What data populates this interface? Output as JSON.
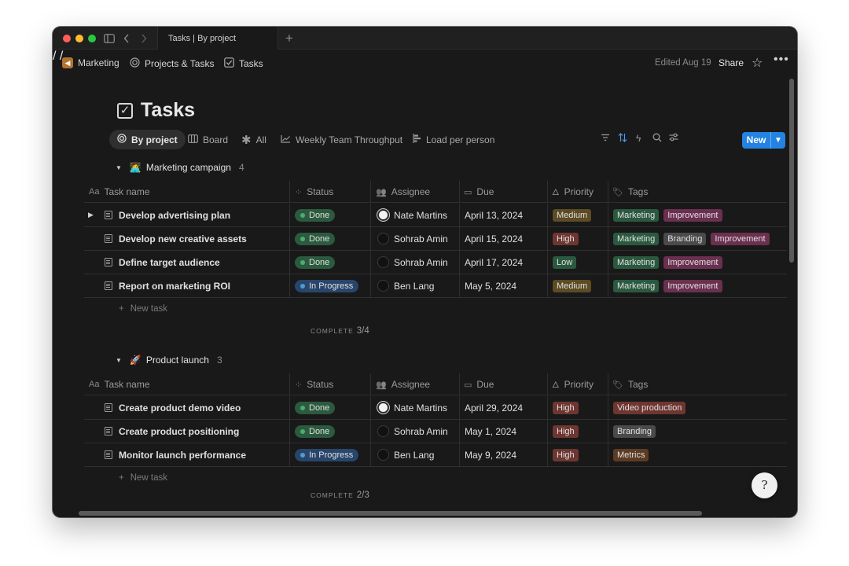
{
  "colors": {
    "done_bg": "#2b5a3e",
    "done_dot": "#4dab6f",
    "inprogress_bg": "#28456c",
    "inprogress_dot": "#529cca",
    "high_bg": "#6e3630",
    "medium_bg": "#5c4b23",
    "low_bg": "#2b593f",
    "accent": "#2383e2"
  },
  "window": {
    "tab_title": "Tasks | By project"
  },
  "breadcrumb": {
    "items": [
      {
        "label": "Marketing",
        "icon": "megaphone-icon"
      },
      {
        "label": "Projects & Tasks",
        "icon": "target-icon"
      },
      {
        "label": "Tasks",
        "icon": "checkbox-icon"
      }
    ]
  },
  "topbar": {
    "edited": "Edited Aug 19",
    "share": "Share"
  },
  "page": {
    "title": "Tasks"
  },
  "views": {
    "items": [
      {
        "label": "By project",
        "icon": "target-icon"
      },
      {
        "label": "Board",
        "icon": "board-icon"
      },
      {
        "label": "All",
        "icon": "asterisk-icon"
      },
      {
        "label": "Weekly Team Throughput",
        "icon": "chart-icon"
      },
      {
        "label": "Load per person",
        "icon": "bars-icon"
      }
    ],
    "new_label": "New"
  },
  "columns": {
    "name": "Task name",
    "status": "Status",
    "assignee": "Assignee",
    "due": "Due",
    "priority": "Priority",
    "tags": "Tags"
  },
  "groups": [
    {
      "emoji": "👩‍💻",
      "name": "Marketing campaign",
      "count": "4",
      "new_task": "New task",
      "complete_label": "COMPLETE",
      "complete_value": "3/4",
      "rows": [
        {
          "name": "Develop advertising plan",
          "status": "Done",
          "assignee": "Nate Martins",
          "avatar": "light",
          "due": "April 13, 2024",
          "priority": "Medium",
          "tags": [
            "Marketing",
            "Improvement"
          ]
        },
        {
          "name": "Develop new creative assets",
          "status": "Done",
          "assignee": "Sohrab Amin",
          "avatar": "dark",
          "due": "April 15, 2024",
          "priority": "High",
          "tags": [
            "Marketing",
            "Branding",
            "Improvement"
          ]
        },
        {
          "name": "Define target audience",
          "status": "Done",
          "assignee": "Sohrab Amin",
          "avatar": "dark",
          "due": "April 17, 2024",
          "priority": "Low",
          "tags": [
            "Marketing",
            "Improvement"
          ]
        },
        {
          "name": "Report on marketing ROI",
          "status": "In Progress",
          "assignee": "Ben Lang",
          "avatar": "dark",
          "due": "May 5, 2024",
          "priority": "Medium",
          "tags": [
            "Marketing",
            "Improvement"
          ]
        }
      ]
    },
    {
      "emoji": "🚀",
      "name": "Product launch",
      "count": "3",
      "new_task": "New task",
      "complete_label": "COMPLETE",
      "complete_value": "2/3",
      "rows": [
        {
          "name": "Create product demo video",
          "status": "Done",
          "assignee": "Nate Martins",
          "avatar": "light",
          "due": "April 29, 2024",
          "priority": "High",
          "tags": [
            "Video production"
          ]
        },
        {
          "name": "Create product positioning",
          "status": "Done",
          "assignee": "Sohrab Amin",
          "avatar": "dark",
          "due": "May 1, 2024",
          "priority": "High",
          "tags": [
            "Branding"
          ]
        },
        {
          "name": "Monitor launch performance",
          "status": "In Progress",
          "assignee": "Ben Lang",
          "avatar": "dark",
          "due": "May 9, 2024",
          "priority": "High",
          "tags": [
            "Metrics"
          ]
        }
      ]
    }
  ],
  "tag_colors": {
    "Marketing": "#2b593f",
    "Improvement": "#6b2f4f",
    "Branding": "#4a4a4a",
    "Video production": "#6e3630",
    "Metrics": "#5c3b23"
  },
  "help_glyph": "?"
}
